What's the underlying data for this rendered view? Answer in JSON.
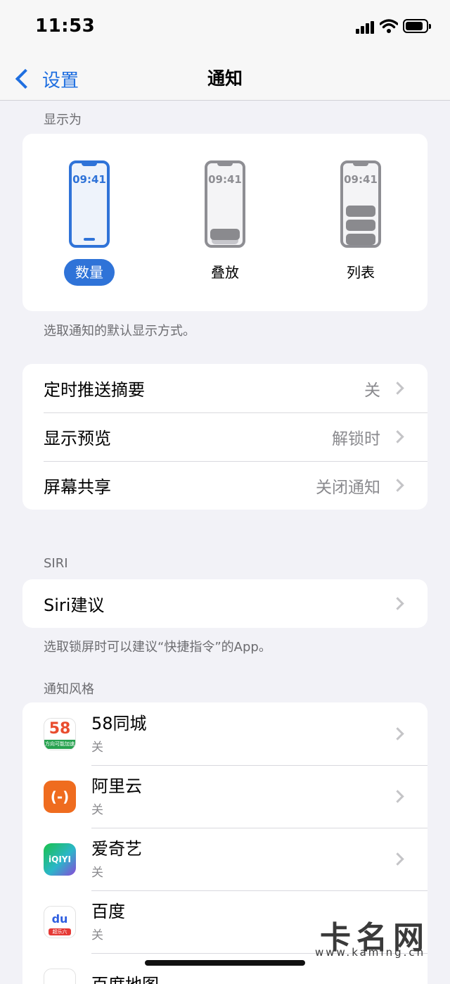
{
  "status_bar": {
    "time": "11:53"
  },
  "nav": {
    "back_label": "设置",
    "title": "通知"
  },
  "display_section": {
    "header": "显示为",
    "preview_clock": "09:41",
    "options": [
      {
        "label": "数量",
        "selected": true
      },
      {
        "label": "叠放",
        "selected": false
      },
      {
        "label": "列表",
        "selected": false
      }
    ],
    "footer": "选取通知的默认显示方式。"
  },
  "settings_rows": [
    {
      "title": "定时推送摘要",
      "value": "关"
    },
    {
      "title": "显示预览",
      "value": "解锁时"
    },
    {
      "title": "屏幕共享",
      "value": "关闭通知"
    }
  ],
  "siri_section": {
    "header": "SIRI",
    "row_title": "Siri建议",
    "footer": "选取锁屏时可以建议“快捷指令”的App。"
  },
  "style_section": {
    "header": "通知风格",
    "apps": [
      {
        "name": "58同城",
        "status": "关",
        "icon": "58-tongcheng-icon"
      },
      {
        "name": "阿里云",
        "status": "关",
        "icon": "aliyun-icon"
      },
      {
        "name": "爱奇艺",
        "status": "关",
        "icon": "iqiyi-icon"
      },
      {
        "name": "百度",
        "status": "关",
        "icon": "baidu-icon"
      },
      {
        "name": "百度地图",
        "status": "",
        "icon": "baidu-map-icon"
      }
    ]
  },
  "icon_text": {
    "fiftyeight": "58",
    "fiftyeight_banner": "方向可能加速",
    "aliyun": "(-)",
    "iqiyi": "iQIYI",
    "baidu": "du",
    "baidu_banner": "超乐六"
  },
  "watermark": {
    "main": "卡名网",
    "url": "www.kaming.cn"
  },
  "colors": {
    "accent": "#2f73d8",
    "background": "#f2f2f7",
    "aliyun": "#ef6c1f",
    "iqiyi": "#19c24a"
  }
}
